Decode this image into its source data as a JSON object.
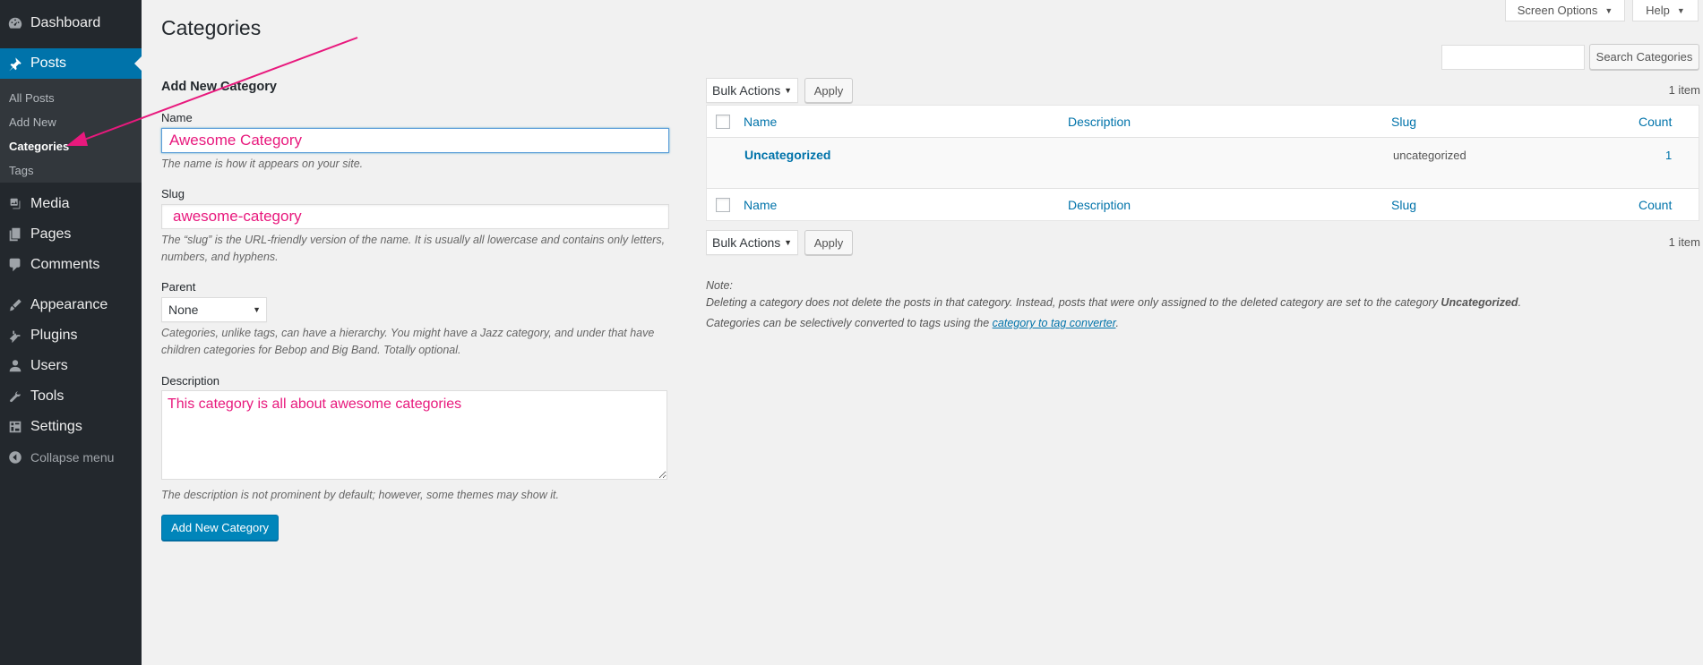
{
  "sidebar": {
    "dashboard": "Dashboard",
    "posts": "Posts",
    "submenu": [
      "All Posts",
      "Add New",
      "Categories",
      "Tags"
    ],
    "media": "Media",
    "pages": "Pages",
    "comments": "Comments",
    "appearance": "Appearance",
    "plugins": "Plugins",
    "users": "Users",
    "tools": "Tools",
    "settings": "Settings",
    "collapse": "Collapse menu"
  },
  "top": {
    "screen_options": "Screen Options",
    "help": "Help"
  },
  "page_title": "Categories",
  "form": {
    "heading": "Add New Category",
    "name_label": "Name",
    "name_value": "Awesome Category",
    "name_desc": "The name is how it appears on your site.",
    "slug_label": "Slug",
    "slug_value": "awesome-category",
    "slug_desc": "The “slug” is the URL-friendly version of the name. It is usually all lowercase and contains only letters, numbers, and hyphens.",
    "parent_label": "Parent",
    "parent_value": "None",
    "parent_desc": "Categories, unlike tags, can have a hierarchy. You might have a Jazz category, and under that have children categories for Bebop and Big Band. Totally optional.",
    "description_label": "Description",
    "description_value": "This category is all about awesome categories",
    "description_desc": "The description is not prominent by default; however, some themes may show it.",
    "submit": "Add New Category"
  },
  "list": {
    "search_button": "Search Categories",
    "bulk_actions": "Bulk Actions",
    "apply": "Apply",
    "item_count": "1 item",
    "columns": {
      "name": "Name",
      "description": "Description",
      "slug": "Slug",
      "count": "Count"
    },
    "rows": [
      {
        "name": "Uncategorized",
        "description": "",
        "slug": "uncategorized",
        "count": "1"
      }
    ]
  },
  "note": {
    "title": "Note:",
    "line1_prefix": "Deleting a category does not delete the posts in that category. Instead, posts that were only assigned to the deleted category are set to the category ",
    "line1_bold": "Uncategorized",
    "line1_suffix": ".",
    "line2_prefix": "Categories can be selectively converted to tags using the ",
    "line2_link": "category to tag converter",
    "line2_suffix": "."
  },
  "colors": {
    "sidebar_bg": "#23282d",
    "active_bg": "#0073aa",
    "link": "#0073aa",
    "annotation": "#e8197d",
    "primary_button": "#0085ba"
  }
}
